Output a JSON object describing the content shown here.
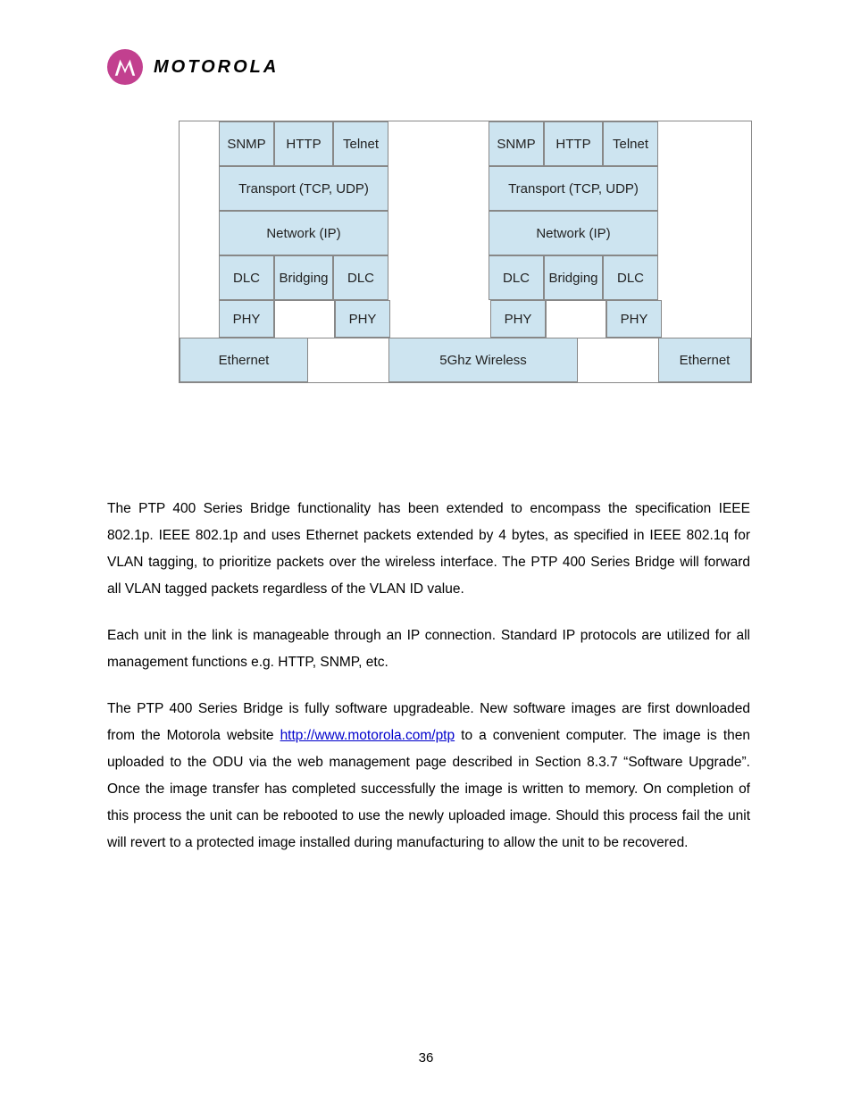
{
  "header": {
    "brand": "MOTOROLA",
    "logo_name": "motorola-batwing-logo"
  },
  "diagram": {
    "stack_left": {
      "apps": [
        "SNMP",
        "HTTP",
        "Telnet"
      ],
      "transport": "Transport (TCP, UDP)",
      "network": "Network (IP)",
      "dlc_row": [
        "DLC",
        "Bridging",
        "DLC"
      ],
      "phy_row": [
        "PHY",
        "",
        "PHY"
      ]
    },
    "stack_right": {
      "apps": [
        "SNMP",
        "HTTP",
        "Telnet"
      ],
      "transport": "Transport (TCP, UDP)",
      "network": "Network (IP)",
      "dlc_row": [
        "DLC",
        "Bridging",
        "DLC"
      ],
      "phy_row": [
        "PHY",
        "",
        "PHY"
      ]
    },
    "bottom": {
      "left": "Ethernet",
      "mid": "5Ghz Wireless",
      "right": "Ethernet"
    }
  },
  "paragraphs": {
    "p1": "The PTP 400 Series Bridge functionality has been extended to encompass the specification IEEE 802.1p. IEEE 802.1p and uses Ethernet packets extended by 4 bytes, as specified in IEEE 802.1q for VLAN tagging, to prioritize packets over the wireless interface. The PTP 400 Series Bridge will forward all VLAN tagged packets regardless of the VLAN ID value.",
    "p2": "Each unit in the link is manageable through an IP connection. Standard IP protocols are utilized for all management functions e.g. HTTP, SNMP, etc.",
    "p3_before": "The PTP 400 Series Bridge is fully software upgradeable. New software images are first downloaded from the Motorola website ",
    "p3_link_text": "http://www.motorola.com/ptp",
    "p3_link_href": "http://www.motorola.com/ptp",
    "p3_after": " to a convenient computer. The image is then uploaded to the ODU via the web management page described in Section 8.3.7 “Software Upgrade”. Once the image transfer has completed successfully the image is written to memory. On completion of this process the unit can be rebooted to use the newly uploaded image. Should this process fail the unit will revert to a protected image installed during manufacturing to allow the unit to be recovered."
  },
  "page_number": "36"
}
